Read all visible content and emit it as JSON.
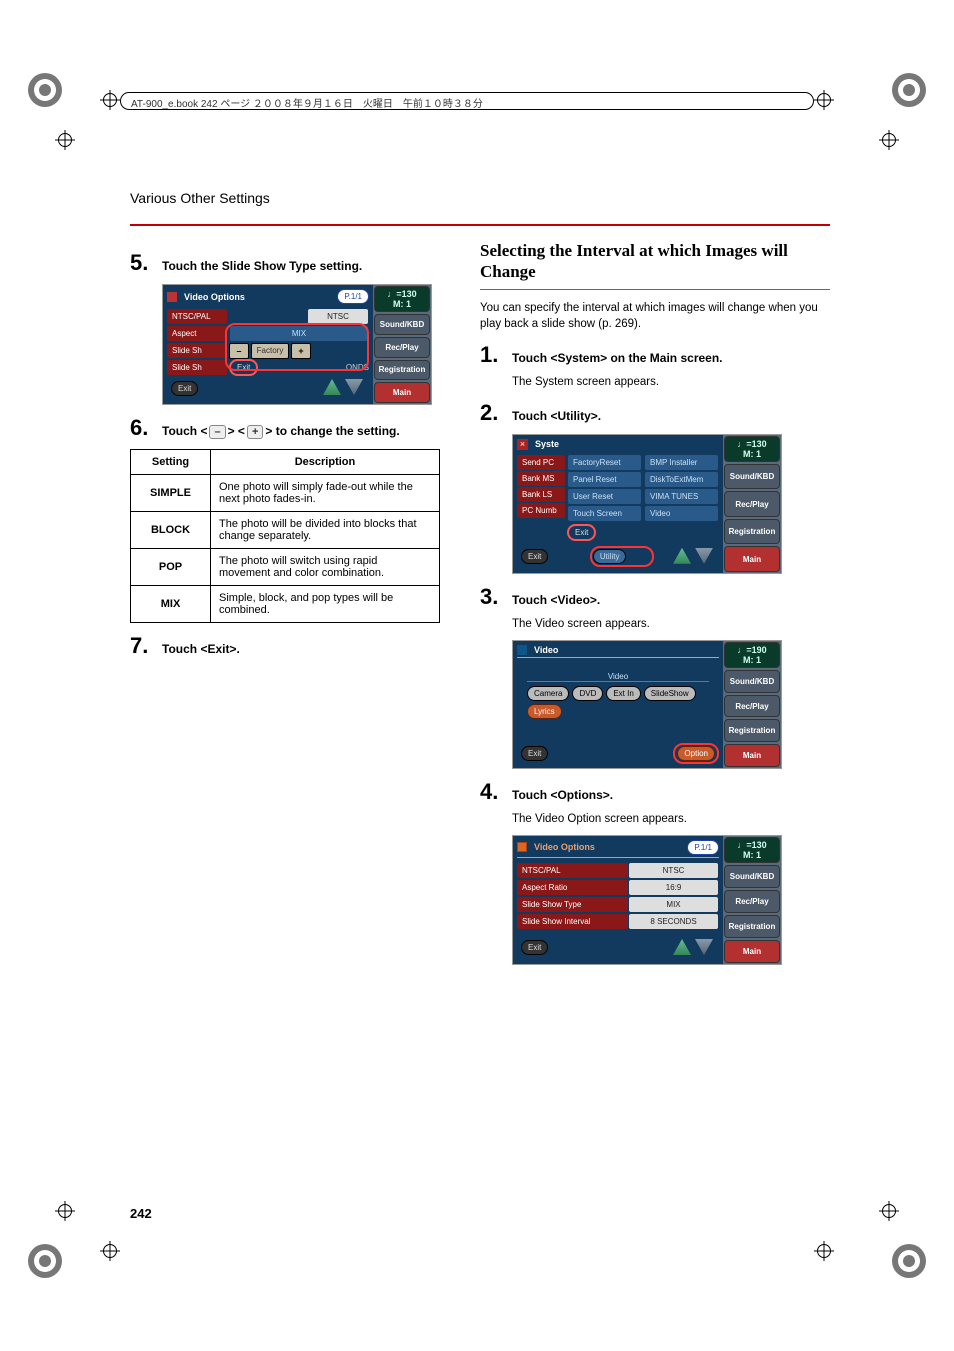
{
  "header_bar": "AT-900_e.book  242 ページ  ２００８年９月１６日　火曜日　午前１０時３８分",
  "section_heading": "Various Other Settings",
  "page_number": "242",
  "left": {
    "steps": {
      "s5": {
        "num": "5.",
        "title": "Touch the Slide Show Type setting."
      },
      "s6": {
        "num": "6.",
        "title_a": "Touch <",
        "title_b": "> <",
        "title_c": "> to change the setting.",
        "minus": "–",
        "plus": "+"
      },
      "s7": {
        "num": "7.",
        "title": "Touch <Exit>."
      }
    },
    "table": {
      "h_setting": "Setting",
      "h_desc": "Description",
      "rows": [
        {
          "name": "SIMPLE",
          "desc": "One photo will simply fade-out while the next photo fades-in."
        },
        {
          "name": "BLOCK",
          "desc": "The photo will be divided into blocks that change separately."
        },
        {
          "name": "POP",
          "desc": "The photo will switch using rapid movement and color combination."
        },
        {
          "name": "MIX",
          "desc": "Simple, block, and pop types will be combined."
        }
      ]
    },
    "shot1": {
      "window_title": "Video Options",
      "page_badge": "P.1/1",
      "tempo": "♩=130",
      "tempo_m": "M:    1",
      "rows": [
        "NTSC/PAL",
        "Aspect",
        "Slide Sh",
        "Slide Sh"
      ],
      "ntsc": "NTSC",
      "mix": "MIX",
      "onds": "ONDS",
      "factory": "Factory",
      "exit": "Exit",
      "sidebar": [
        "Sound/KBD",
        "Rec/Play",
        "Registration",
        "Main"
      ]
    }
  },
  "right": {
    "subheading": "Selecting the Interval at which Images will Change",
    "intro": "You can specify the interval at which images will change when you play back a slide show (p. 269).",
    "steps": {
      "s1": {
        "num": "1.",
        "title": "Touch <System> on the Main screen.",
        "body": "The System screen appears."
      },
      "s2": {
        "num": "2.",
        "title": "Touch <Utility>."
      },
      "s3": {
        "num": "3.",
        "title": "Touch <Video>.",
        "body": "The Video screen appears."
      },
      "s4": {
        "num": "4.",
        "title": "Touch <Options>.",
        "body": "The Video Option screen appears."
      }
    },
    "shot_util": {
      "title": "Syste",
      "rows_left": [
        "Send PC",
        "Bank MS",
        "Bank LS",
        "PC Numb"
      ],
      "menu": [
        [
          "FactoryReset",
          "BMP Installer"
        ],
        [
          "Panel Reset",
          "DiskToExtMem"
        ],
        [
          "User Reset",
          "VIMA TUNES"
        ],
        [
          "Touch Screen",
          "Video"
        ]
      ],
      "exit": "Exit",
      "utility": "Utility",
      "tempo": "♩=130",
      "tempo_m": "M:    1",
      "sidebar": [
        "Sound/KBD",
        "Rec/Play",
        "Registration",
        "Main"
      ]
    },
    "shot_video": {
      "title": "Video",
      "label": "Video",
      "buttons": [
        "Camera",
        "DVD",
        "Ext In",
        "SlideShow",
        "Lyrics"
      ],
      "exit": "Exit",
      "option": "Option",
      "tempo": "♩=190",
      "tempo_m": "M:    1",
      "sidebar": [
        "Sound/KBD",
        "Rec/Play",
        "Registration",
        "Main"
      ]
    },
    "shot_options": {
      "title": "Video Options",
      "page_badge": "P.1/1",
      "rows": [
        {
          "label": "NTSC/PAL",
          "value": "NTSC"
        },
        {
          "label": "Aspect Ratio",
          "value": "16:9"
        },
        {
          "label": "Slide Show Type",
          "value": "MIX"
        },
        {
          "label": "Slide Show Interval",
          "value": "8 SECONDS"
        }
      ],
      "exit": "Exit",
      "tempo": "♩=130",
      "tempo_m": "M:    1",
      "sidebar": [
        "Sound/KBD",
        "Rec/Play",
        "Registration",
        "Main"
      ]
    }
  }
}
